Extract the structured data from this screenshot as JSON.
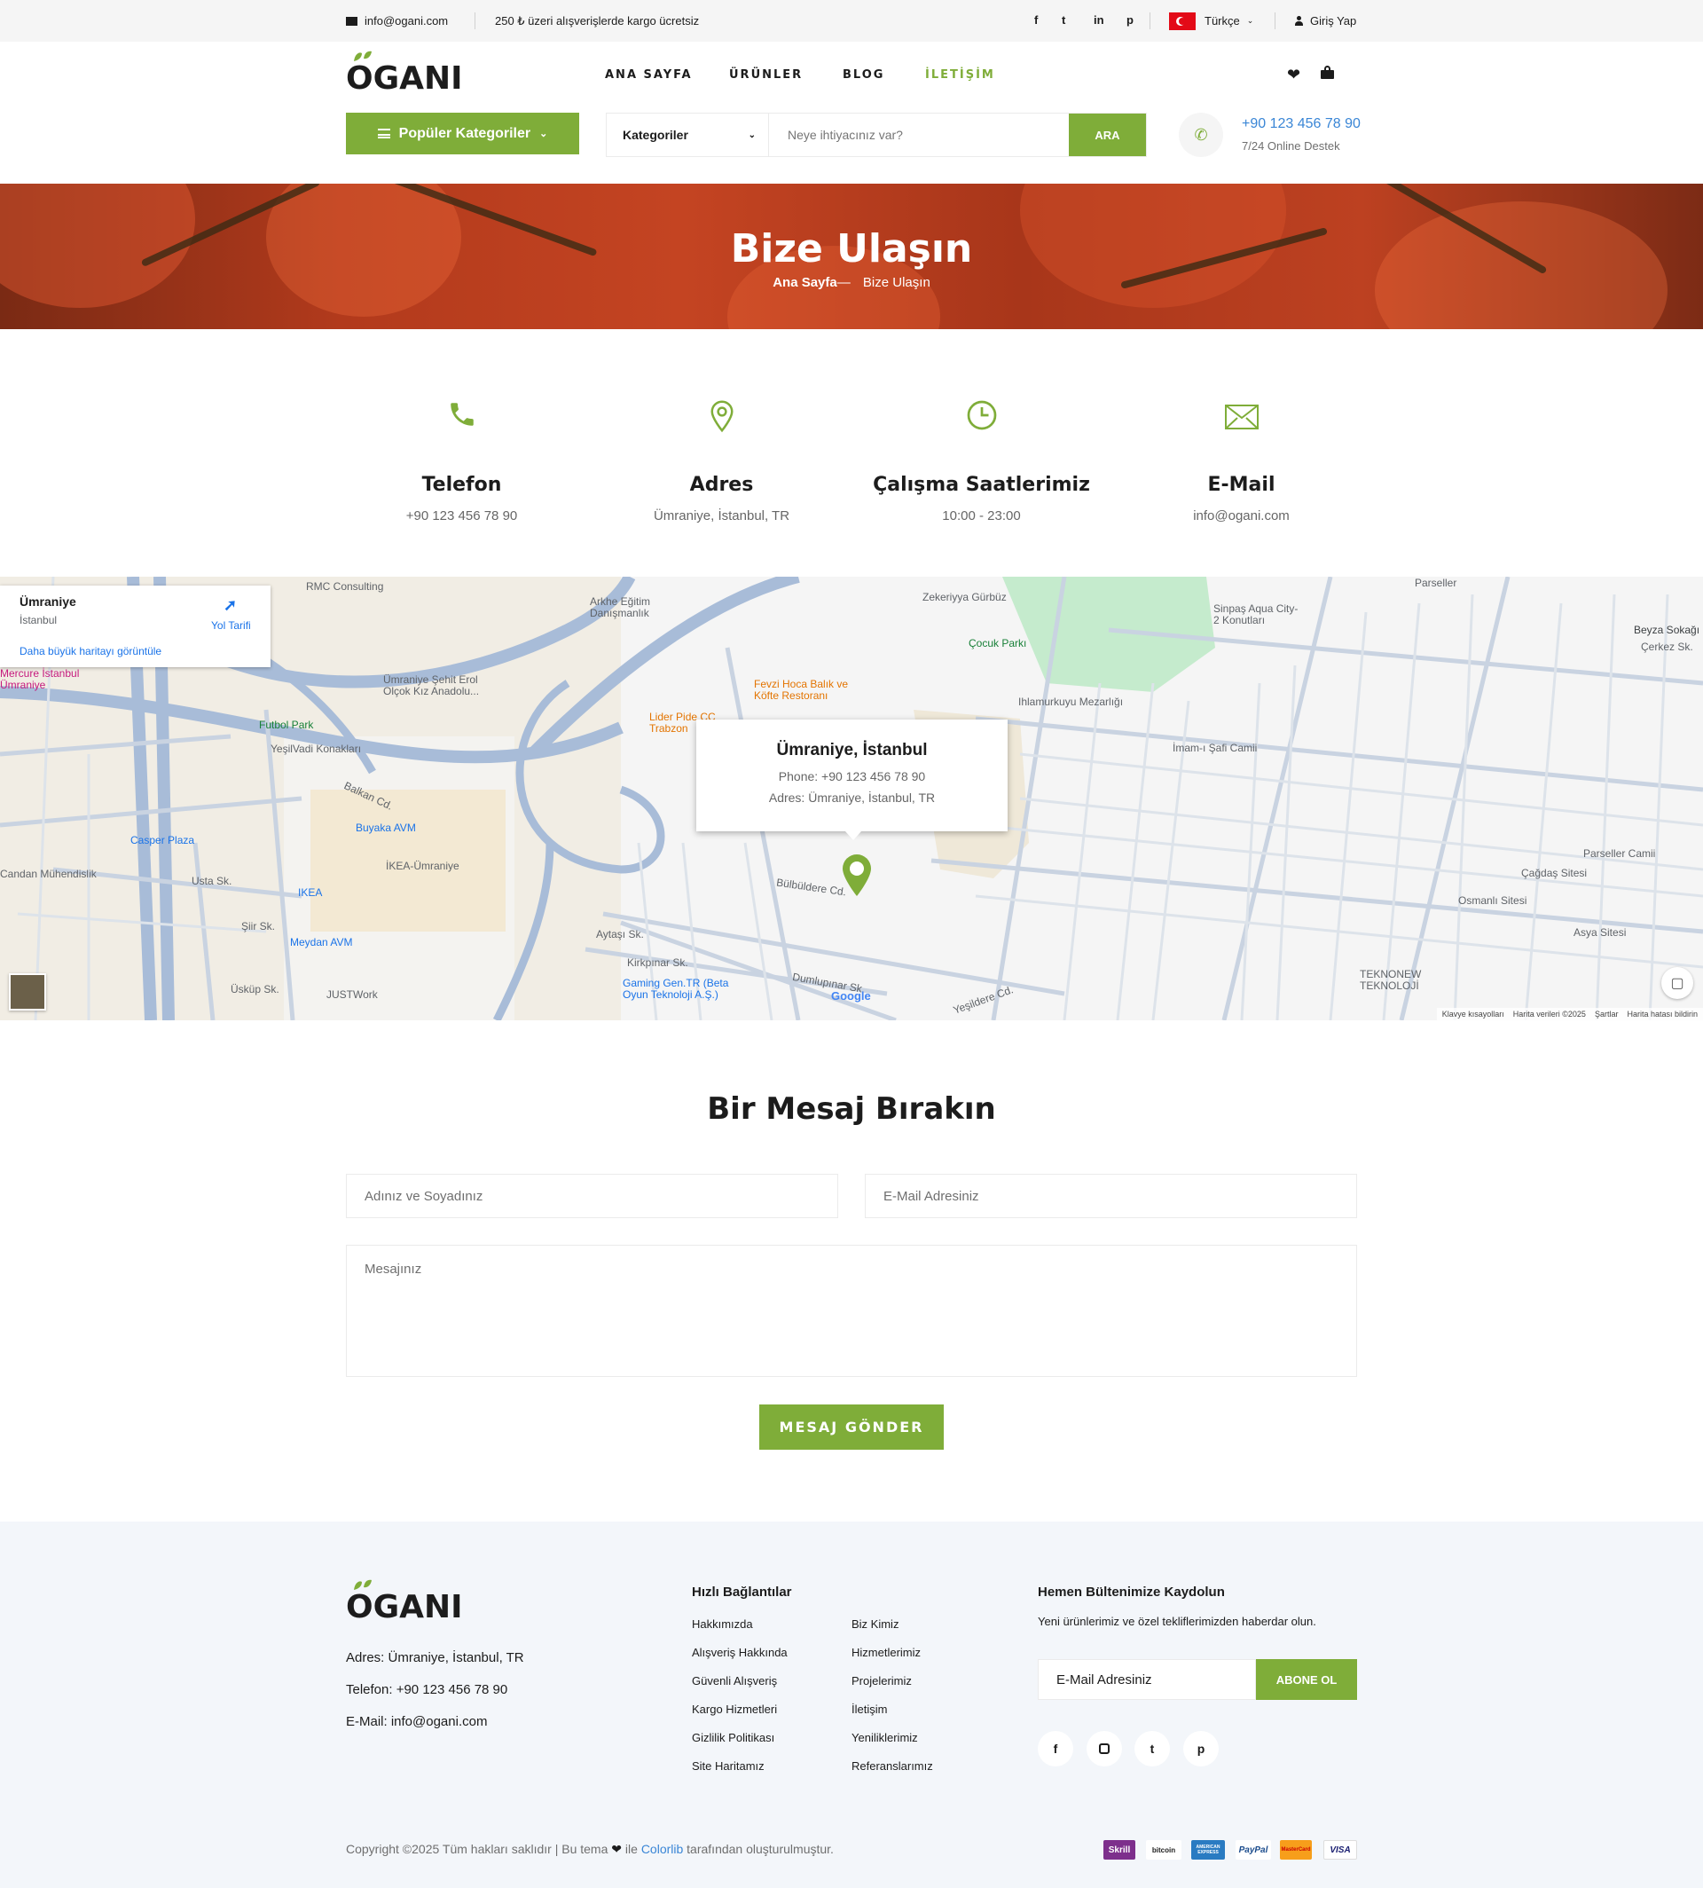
{
  "topbar": {
    "email": "info@ogani.com",
    "shipping": "250 ₺ üzeri alışverişlerde kargo ücretsiz",
    "social": [
      "f",
      "t",
      "in",
      "p"
    ],
    "language": "Türkçe",
    "login": "Giriş Yap"
  },
  "header": {
    "logo": "OGANI",
    "nav": [
      "ANA SAYFA",
      "ÜRÜNLER",
      "BLOG",
      "İLETİŞİM"
    ],
    "active_nav": "İLETİŞİM",
    "categories_button": "Popüler Kategoriler",
    "search": {
      "category": "Kategoriler",
      "placeholder": "Neye ihtiyacınız var?",
      "button": "ARA"
    },
    "phone": "+90 123 456 78 90",
    "support": "7/24 Online Destek"
  },
  "hero": {
    "title": "Bize Ulaşın",
    "breadcrumb_home": "Ana Sayfa",
    "breadcrumb_sep": "—",
    "breadcrumb_current": "Bize Ulaşın"
  },
  "contact": [
    {
      "icon": "phone-icon",
      "title": "Telefon",
      "value": "+90 123 456 78 90"
    },
    {
      "icon": "location-pin-icon",
      "title": "Adres",
      "value": "Ümraniye, İstanbul, TR"
    },
    {
      "icon": "clock-icon",
      "title": "Çalışma Saatlerimiz",
      "value": "10:00 - 23:00"
    },
    {
      "icon": "envelope-icon",
      "title": "E-Mail",
      "value": "info@ogani.com"
    }
  ],
  "map": {
    "place_card": {
      "title": "Ümraniye",
      "subtitle": "İstanbul",
      "directions": "Yol Tarifi",
      "larger_map": "Daha büyük haritayı görüntüle"
    },
    "info_window": {
      "title": "Ümraniye, İstanbul",
      "phone": "Phone: +90 123 456 78 90",
      "address": "Adres: Ümraniye, İstanbul, TR"
    },
    "labels": [
      "RMC Consulting",
      "Arkhe Eğitim Danışmanlık",
      "Zekeriyya Gürbüz",
      "Parseller",
      "Sinpaş Aqua City-2 Konutları",
      "Çocuk Parkı",
      "Fevzi Hoca Balık ve Köfte Restoranı",
      "Lider Pide CC Trabzon",
      "Ihlamurkuyu Mezarlığı",
      "Futbol Park",
      "YeşilVadi Konakları",
      "Casper Plaza",
      "Buyaka AVM",
      "İKEA-Ümraniye",
      "IKEA",
      "Meydan AVM",
      "JUSTWork",
      "Candan Mühendislik",
      "Mercure İstanbul Ümraniye",
      "Gaming Gen.TR (Beta Oyun Teknoloji A.Ş.)",
      "Çağdaş Sitesi",
      "Osmanlı Sitesi",
      "Asya Sitesi",
      "Parseller Camii",
      "TEKNONEW TEKNOLOJİ",
      "İmam-ı Şafi Camii",
      "Beyza Sokağı",
      "Çerkez Sk.",
      "Ümraniye Şehit Erol Olçok Kız Anadolu...",
      "Bülbüldere Cd.",
      "Yeşildere Cd.",
      "Balkan Cd.",
      "Üsküp Sk.",
      "Şiir Sk.",
      "Usta Sk.",
      "Aytaşı Sk.",
      "Kirkpınar Sk.",
      "Dumlupınar Sk."
    ],
    "footer_links": [
      "Klavye kısayolları",
      "Harita verileri ©2025",
      "Şartlar",
      "Harita hatası bildirin"
    ]
  },
  "form": {
    "title": "Bir Mesaj Bırakın",
    "name_placeholder": "Adınız ve Soyadınız",
    "email_placeholder": "E-Mail Adresiniz",
    "message_placeholder": "Mesajınız",
    "submit": "MESAJ GÖNDER"
  },
  "footer": {
    "logo": "OGANI",
    "address": "Adres: Ümraniye, İstanbul, TR",
    "phone": "Telefon: +90 123 456 78 90",
    "email": "E-Mail: info@ogani.com",
    "links_title": "Hızlı Bağlantılar",
    "links_col1": [
      "Hakkımızda",
      "Alışveriş Hakkında",
      "Güvenli Alışveriş",
      "Kargo Hizmetleri",
      "Gizlilik Politikası",
      "Site Haritamız"
    ],
    "links_col2": [
      "Biz Kimiz",
      "Hizmetlerimiz",
      "Projelerimiz",
      "İletişim",
      "Yeniliklerimiz",
      "Referanslarımız"
    ],
    "newsletter_title": "Hemen Bültenimize Kaydolun",
    "newsletter_text": "Yeni ürünlerimiz ve özel tekliflerimizden haberdar olun.",
    "newsletter_placeholder": "E-Mail Adresiniz",
    "newsletter_button": "ABONE OL",
    "copyright_pre": "Copyright ©2025 Tüm hakları saklıdır | Bu tema",
    "copyright_mid": "ile",
    "copyright_brand": "Colorlib",
    "copyright_post": "tarafından oluşturulmuştur.",
    "payments": [
      "Skrill",
      "bitcoin",
      "AMERICAN EXPRESS",
      "PayPal",
      "MasterCard",
      "VISA"
    ]
  },
  "colors": {
    "accent": "#7fad39",
    "text": "#1c1c1c",
    "muted": "#6f6f6f",
    "link": "#3a86d6"
  }
}
